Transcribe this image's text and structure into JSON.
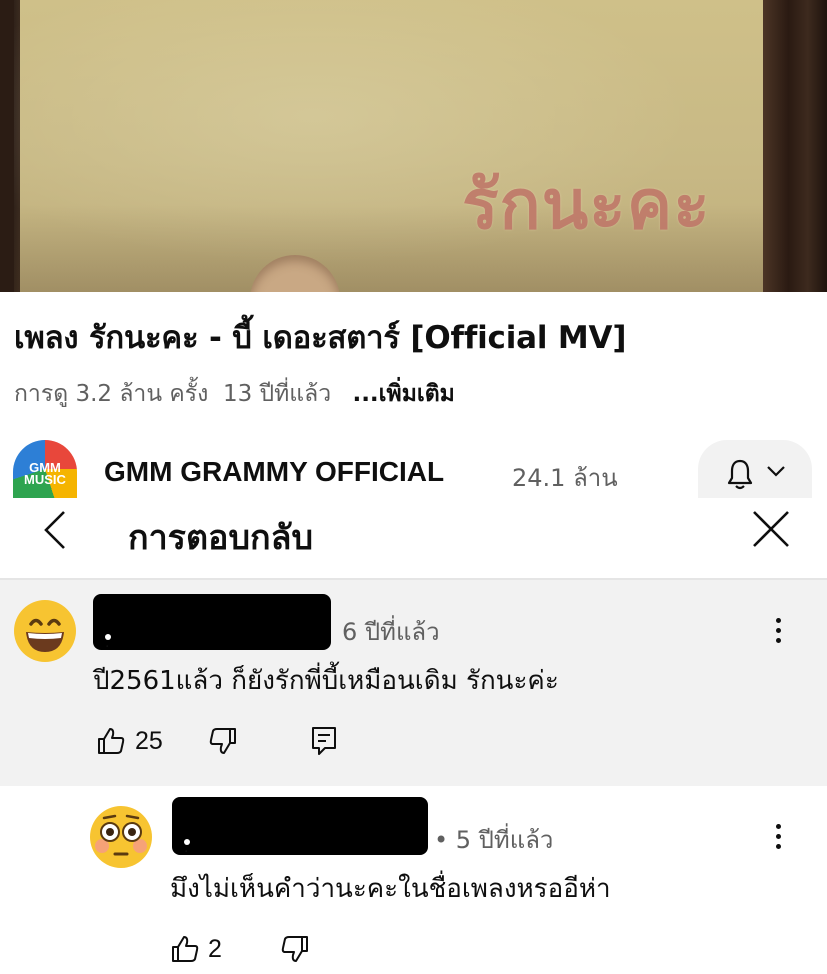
{
  "video": {
    "overlay_text": "รักนะคะ",
    "title": "เพลง รักนะคะ - บี้ เดอะสตาร์  [Official MV]",
    "views": "การดู 3.2 ล้าน ครั้ง",
    "age": "13 ปีที่แล้ว",
    "more_label": "...เพิ่มเติม"
  },
  "channel": {
    "avatar_text": "GMM\nMUSIC",
    "name": "GMM GRAMMY OFFICIAL",
    "subscribers": "24.1 ล้าน",
    "icons": {
      "bell": "bell-icon",
      "chevron": "chevron-down-icon"
    }
  },
  "panel": {
    "title": "การตอบกลับ",
    "icons": {
      "back": "chevron-left-icon",
      "close": "close-icon"
    }
  },
  "comments": [
    {
      "avatar": "grinning-face-emoji",
      "author_visible": ".",
      "time": "6 ปีที่แล้ว",
      "text": "ปี2561แล้ว ก็ยังรักพี่บี้เหมือนเดิม รักนะค่ะ",
      "likes": "25",
      "highlighted": true
    },
    {
      "avatar": "flushed-face-emoji",
      "author_visible": ".",
      "time": "• 5 ปีที่แล้ว",
      "text": "มึงไม่เห็นคำว่านะคะในชื่อเพลงหรออีห่า",
      "likes": "2",
      "highlighted": false
    }
  ],
  "colors": {
    "accent_bg": "#f2f2f2",
    "text": "#0f0f0f",
    "secondary": "#606060"
  }
}
